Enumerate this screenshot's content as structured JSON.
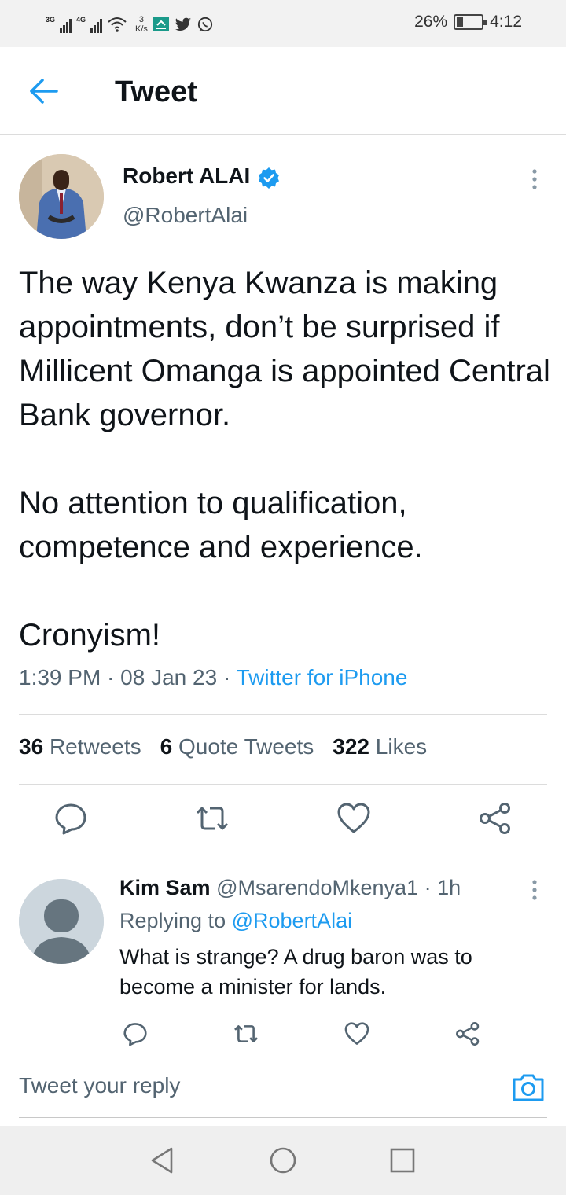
{
  "status_bar": {
    "net1": "3G",
    "net2": "4G",
    "speed_value": "3",
    "speed_unit": "K/s",
    "battery": "26%",
    "time": "4:12"
  },
  "header": {
    "title": "Tweet"
  },
  "tweet": {
    "author_name": "Robert ALAI",
    "handle": "@RobertAlai",
    "body_p1": "The way Kenya Kwanza is making appointments, don’t be surprised if Millicent Omanga is appointed Central Bank governor.",
    "body_p2": "No attention to qualification, competence and experience.",
    "body_p3": "Cronyism!",
    "time": "1:39 PM",
    "date": "08 Jan 23",
    "source": "Twitter for iPhone",
    "retweets_count": "36",
    "retweets_label": "Retweets",
    "quotes_count": "6",
    "quotes_label": "Quote Tweets",
    "likes_count": "322",
    "likes_label": "Likes"
  },
  "reply": {
    "name": "Kim Sam",
    "handle": "@MsarendoMkenya1",
    "age": "1h",
    "replying_prefix": "Replying to",
    "replying_to": "@RobertAlai",
    "text": "What is strange? A drug baron was to become a minister for lands."
  },
  "composer": {
    "placeholder": "Tweet your reply"
  },
  "colors": {
    "accent": "#1d9bf0",
    "secondary_text": "#536471",
    "primary_text": "#0f1419"
  }
}
